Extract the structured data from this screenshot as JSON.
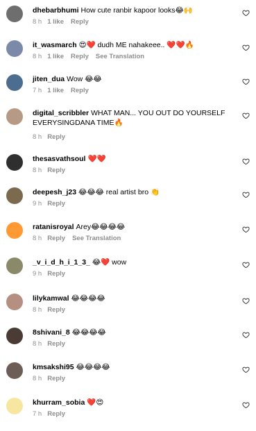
{
  "comments": [
    {
      "user": "dhebarbhumi",
      "text": "How cute ranbir kapoor looks😂🙌",
      "time": "8 h",
      "likes": "1 like",
      "reply": "Reply",
      "translate": ""
    },
    {
      "user": "it_wasmarch",
      "text": "😍❤️ dudh ME nahakeee.. ❤️❤️🔥",
      "time": "8 h",
      "likes": "1 like",
      "reply": "Reply",
      "translate": "See Translation"
    },
    {
      "user": "jiten_dua",
      "text": "Wow 😂😂",
      "time": "7 h",
      "likes": "1 like",
      "reply": "Reply",
      "translate": ""
    },
    {
      "user": "digital_scribbler",
      "text": "WHAT MAN... YOU OUT DO YOURSELF EVERYSINGDANA TIME🔥",
      "time": "8 h",
      "likes": "",
      "reply": "Reply",
      "translate": ""
    },
    {
      "user": "thesasvathsoul",
      "text": "❤️❤️",
      "time": "8 h",
      "likes": "",
      "reply": "Reply",
      "translate": ""
    },
    {
      "user": "deepesh_j23",
      "text": "😂😂😂 real artist bro 👏",
      "time": "9 h",
      "likes": "",
      "reply": "Reply",
      "translate": ""
    },
    {
      "user": "ratanisroyal",
      "text": "Arey😂😂😂😂",
      "time": "8 h",
      "likes": "",
      "reply": "Reply",
      "translate": "See Translation"
    },
    {
      "user": "_v_i_d_h_i_1_3_",
      "text": "😂❤️ wow",
      "time": "9 h",
      "likes": "",
      "reply": "Reply",
      "translate": ""
    },
    {
      "user": "lilykamwal",
      "text": "😂😂😂😂",
      "time": "8 h",
      "likes": "",
      "reply": "Reply",
      "translate": ""
    },
    {
      "user": "8shivani_8",
      "text": "😂😂😂😂",
      "time": "8 h",
      "likes": "",
      "reply": "Reply",
      "translate": ""
    },
    {
      "user": "kmsakshi95",
      "text": "😂😂😂😂",
      "time": "8 h",
      "likes": "",
      "reply": "Reply",
      "translate": ""
    },
    {
      "user": "khurram_sobia",
      "text": "❤️😍",
      "time": "7 h",
      "likes": "",
      "reply": "Reply",
      "translate": ""
    }
  ],
  "colors": {
    "meta": "#8e8e8e",
    "avatar_fallback": "#c9c9c9"
  }
}
